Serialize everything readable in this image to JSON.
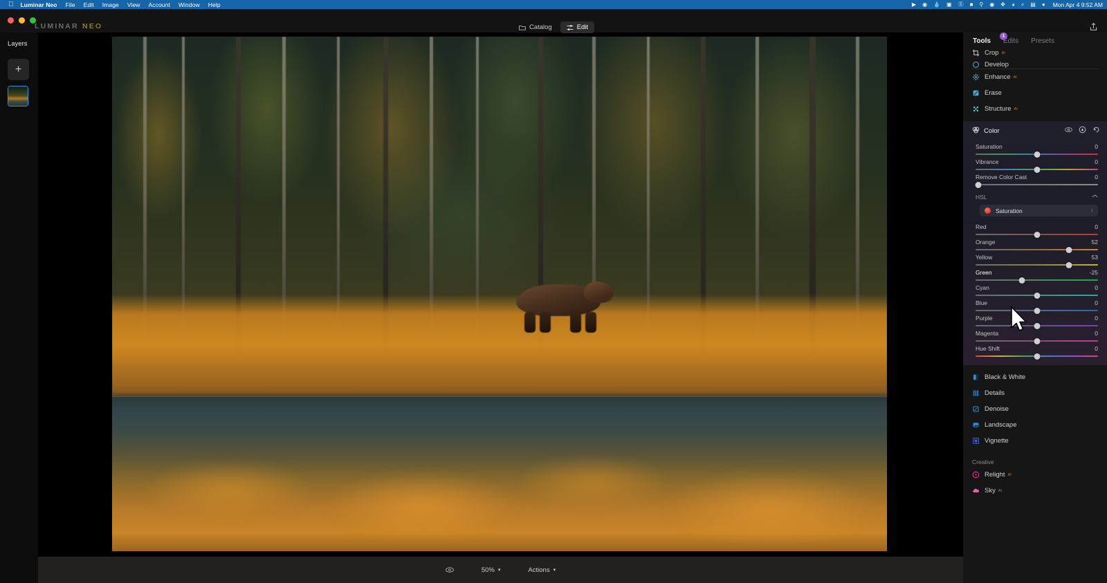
{
  "menubar": {
    "apple_icon": "apple-icon",
    "items": [
      {
        "label": "Luminar Neo",
        "bold": true
      },
      {
        "label": "File"
      },
      {
        "label": "Edit"
      },
      {
        "label": "Image"
      },
      {
        "label": "View"
      },
      {
        "label": "Account"
      },
      {
        "label": "Window"
      },
      {
        "label": "Help"
      }
    ],
    "status_icons": [
      "screen-record-icon",
      "cleanmymac-icon",
      "droplet-icon",
      "window-manager-icon",
      "sound-icon",
      "battery-icon",
      "wifi-mesh-icon",
      "time-machine-icon",
      "bluetooth-icon",
      "wifi-icon",
      "search-icon",
      "control-center-icon",
      "siri-icon"
    ],
    "clock": "Mon Apr 4  9:52 AM"
  },
  "titlebar": {
    "brand_main": "LUMINAR",
    "brand_accent": "NEO",
    "tabs": [
      {
        "label": "Catalog",
        "icon": "folder-icon",
        "active": false
      },
      {
        "label": "Edit",
        "icon": "sliders-icon",
        "active": true
      }
    ],
    "share_icon": "share-icon"
  },
  "left_rail": {
    "title": "Layers",
    "add_label": "+",
    "thumbnail_name": "layer-thumbnail"
  },
  "bottom_bar": {
    "compare_icon": "compare-eye-icon",
    "zoom_level": "50%",
    "actions_label": "Actions"
  },
  "right_panel": {
    "tabs": [
      {
        "label": "Tools",
        "active": true
      },
      {
        "label": "Edits",
        "active": false,
        "badge": "1"
      },
      {
        "label": "Presets",
        "active": false
      }
    ],
    "essential_tools": [
      {
        "label": "Crop",
        "icon": "crop-icon",
        "ai": "AI",
        "color": "#cfcfcf"
      },
      {
        "label": "Develop",
        "icon": "develop-icon",
        "ai": "",
        "color": "#3fa9d8",
        "clipped": true
      },
      {
        "label": "Enhance",
        "icon": "enhance-icon",
        "ai": "AI",
        "color": "#4ec8e0"
      },
      {
        "label": "Erase",
        "icon": "erase-icon",
        "ai": "",
        "color": "#3fa9d8"
      },
      {
        "label": "Structure",
        "icon": "structure-icon",
        "ai": "AI",
        "color": "#4ec8e0"
      }
    ],
    "color_module": {
      "title": "Color",
      "icon": "color-icon",
      "header_icons": [
        "eye-icon",
        "mask-icon",
        "reset-icon"
      ],
      "sliders": [
        {
          "name": "Saturation",
          "value": "0",
          "pos": 50,
          "gradient": "linear-gradient(90deg,#6a6a6a,#3d9a58,#3b74b8,#9a3a8c,#c0392b)"
        },
        {
          "name": "Vibrance",
          "value": "0",
          "pos": 50,
          "gradient": "linear-gradient(90deg,#6a6a6a,#4a7fb5,#4aa35f,#b8a23e,#c04a7a)"
        },
        {
          "name": "Remove Color Cast",
          "value": "0",
          "pos": 2,
          "gradient": "linear-gradient(90deg,#6e6e6e,#8b8b8b)"
        }
      ],
      "hsl": {
        "title": "HSL",
        "collapse_icon": "chevron-up-icon",
        "selector": {
          "label": "Saturation",
          "swatch": "#e0382a",
          "chevron": "chevron-updown-icon"
        },
        "sliders": [
          {
            "name": "Red",
            "value": "0",
            "pos": 50,
            "gradient": "linear-gradient(90deg,#6b6b6b,#8a5050,#c0392b)",
            "active": false
          },
          {
            "name": "Orange",
            "value": "52",
            "pos": 76,
            "gradient": "linear-gradient(90deg,#6b6b6b,#8a6a45,#d2822c)",
            "active": false
          },
          {
            "name": "Yellow",
            "value": "53",
            "pos": 76,
            "gradient": "linear-gradient(90deg,#6b6b6b,#8a8350,#c9b23a)",
            "active": false
          },
          {
            "name": "Green",
            "value": "-25",
            "pos": 38,
            "gradient": "linear-gradient(90deg,#6b6b6b,#4d8a5c,#1fa84a)",
            "active": true
          },
          {
            "name": "Cyan",
            "value": "0",
            "pos": 50,
            "gradient": "linear-gradient(90deg,#6b6b6b,#4f8a86,#2fa8a0)",
            "active": false
          },
          {
            "name": "Blue",
            "value": "0",
            "pos": 50,
            "gradient": "linear-gradient(90deg,#6b6b6b,#4f6a96,#2f63b8)",
            "active": false
          },
          {
            "name": "Purple",
            "value": "0",
            "pos": 50,
            "gradient": "linear-gradient(90deg,#6b6b6b,#6a5090,#7a3fb8)",
            "active": false
          },
          {
            "name": "Magenta",
            "value": "0",
            "pos": 50,
            "gradient": "linear-gradient(90deg,#6b6b6b,#8a4f7a,#c03a9a)",
            "active": false
          }
        ],
        "hue_shift": {
          "name": "Hue Shift",
          "value": "0",
          "pos": 50,
          "gradient": "linear-gradient(90deg,#d24a3a,#c9b23a,#3fa85c,#3f7ec9,#9a4ac9,#d24a6a)"
        }
      }
    },
    "more_tools": [
      {
        "label": "Black & White",
        "icon": "bw-icon",
        "color": "#2f8fe0"
      },
      {
        "label": "Details",
        "icon": "details-icon",
        "color": "#2f8fe0"
      },
      {
        "label": "Denoise",
        "icon": "denoise-icon",
        "color": "#2f8fe0"
      },
      {
        "label": "Landscape",
        "icon": "landscape-icon",
        "color": "#2f8fe0"
      },
      {
        "label": "Vignette",
        "icon": "vignette-icon",
        "color": "#2f5fe0"
      }
    ],
    "creative": {
      "title": "Creative",
      "items": [
        {
          "label": "Relight",
          "icon": "relight-icon",
          "ai": "AI",
          "color": "#e0399a"
        },
        {
          "label": "Sky",
          "icon": "sky-icon",
          "ai": "AI",
          "color": "#f05ab0"
        }
      ]
    }
  },
  "colors": {
    "menubar_blue": "#1565a8",
    "accent_orange": "#d2792a",
    "selection_blue": "#2f8fe0",
    "badge_purple": "#8d4fd4"
  }
}
